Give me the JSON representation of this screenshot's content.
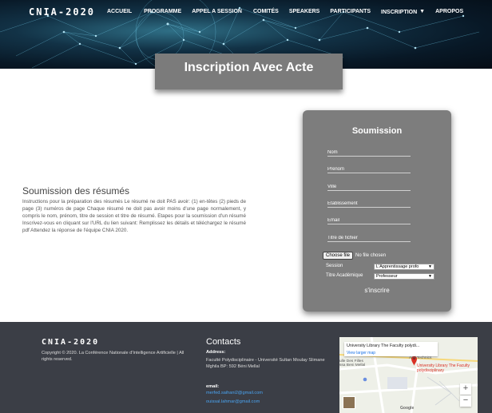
{
  "nav": {
    "brand": "CNIA-2020",
    "items": [
      "ACCUEIL",
      "PROGRAMME",
      "APPEL A SESSION",
      "COMITÉS",
      "SPEAKERS",
      "PARTICIPANTS",
      "INSCRIPTION",
      "APROPOS"
    ]
  },
  "hero": {
    "title": "Inscription Avec Acte"
  },
  "section": {
    "title": "Soumission des résumés",
    "body": "Instructions pour la préparation des résumés Le résumé ne doit PAS avoir: (1) en-têtes (2) pieds de page (3) numéros de page Chaque résumé ne doit pas avoir moins d'une page normalement, y compris le nom, prénom, titre de session et titre de résumé. Etapes pour la soumission d'un résumé Inscrivez-vous en cliquant sur l'URL du lien suivant: Remplissez les détails et téléchargez le résumé pdf Attendez la réponse de l'équipe CNIA 2020."
  },
  "form": {
    "title": "Soumission",
    "fields": [
      "Nom",
      "Prenom",
      "Ville",
      "Etablissement",
      "Email",
      "Titre de fichier"
    ],
    "file_button": "Choose file",
    "file_status": "No file chosen",
    "session_label": "Session",
    "session_value": "L'Apprentissage profo",
    "titre_label": "Titre Académique",
    "titre_value": "Professeur",
    "submit": "s'inscrire"
  },
  "footer": {
    "brand": "CNIA-2020",
    "copyright": "Copyright © 2020. La Conférence Nationale d'Intelligence Artificielle | All rights reserved.",
    "contacts_title": "Contacts",
    "address_label": "Address:",
    "address": "Faculté Polydisciplinaire - Université Sultan Moulay Slimane Mghila BP: 592 Béni Mellal",
    "email_label": "email:",
    "emails": [
      "merfed.saihani2@gmail.com",
      "ouissal.lahmar@gmail.com"
    ]
  },
  "map": {
    "place": "University Library The Faculty polydi...",
    "larger": "View larger map",
    "label_and_technics": "And Technics",
    "label_pin": "University Library The Faculty polydisciplinary",
    "label_left": "ulle Des Filles ssa Beni Mellal",
    "zoom_in": "+",
    "zoom_out": "−",
    "google": "Google"
  },
  "colors": {
    "footer_bg": "#3b3e46",
    "card_bg": "#7d7d7d",
    "link": "#4aa3f0"
  }
}
